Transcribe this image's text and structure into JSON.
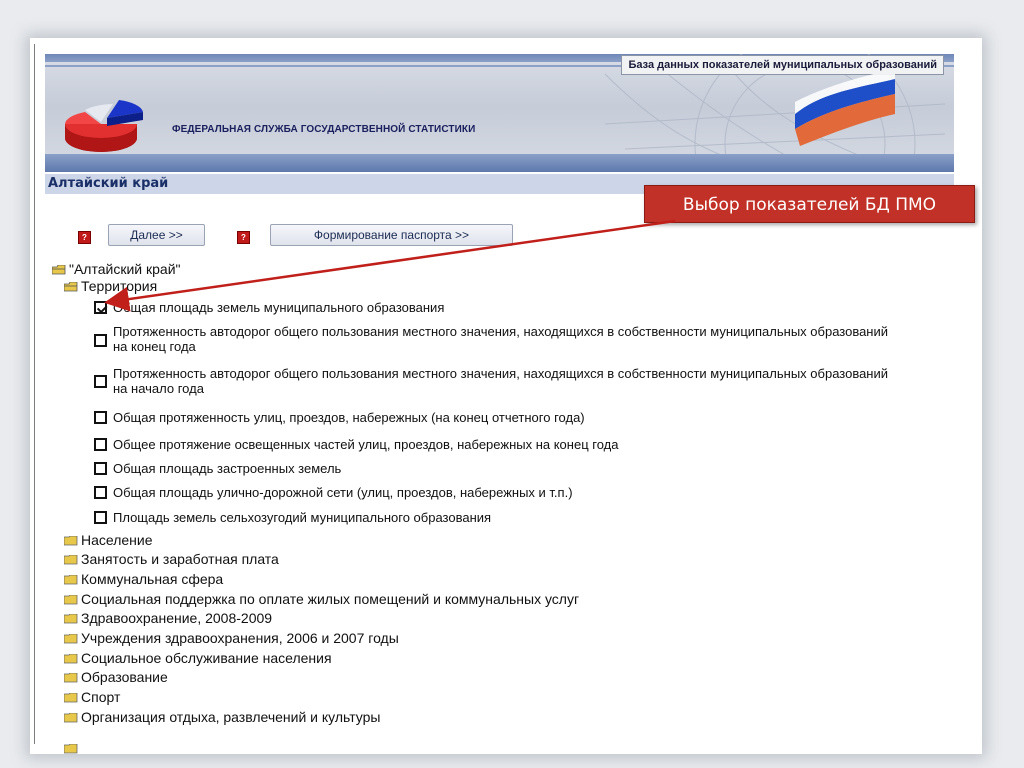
{
  "header": {
    "db_title": "База данных показателей муниципальных образований",
    "agency": "ФЕДЕРАЛЬНАЯ СЛУЖБА ГОСУДАРСТВЕННОЙ СТАТИСТИКИ"
  },
  "region_title": "Алтайский край",
  "callout": "Выбор показателей БД ПМО",
  "buttons": {
    "help_glyph": "?",
    "next": "Далее >>",
    "passport": "Формирование паспорта >>"
  },
  "tree": {
    "root": "\"Алтайский край\"",
    "open_section": "Территория",
    "indicators": [
      {
        "label": "Общая площадь земель муниципального образования",
        "checked": true
      },
      {
        "label": "Протяженность автодорог общего пользования местного значения, находящихся в собственности муниципальных образований на конец года",
        "checked": false
      },
      {
        "label": "Протяженность автодорог общего пользования местного значения, находящихся в собственности муниципальных образований на начало года",
        "checked": false
      },
      {
        "label": "Общая протяженность улиц, проездов, набережных (на конец отчетного года)",
        "checked": false
      },
      {
        "label": "Общее протяжение освещенных частей улиц, проездов, набережных на конец года",
        "checked": false
      },
      {
        "label": "Общая площадь застроенных земель",
        "checked": false
      },
      {
        "label": "Общая площадь улично-дорожной сети (улиц, проездов, набережных и т.п.)",
        "checked": false
      },
      {
        "label": "Площадь земель сельхозугодий муниципального образования",
        "checked": false
      }
    ],
    "sections": [
      "Население",
      "Занятость и заработная плата",
      "Коммунальная сфера",
      "Социальная поддержка по оплате жилых помещений и коммунальных услуг",
      "Здравоохранение, 2008-2009",
      "Учреждения здравоохранения, 2006 и 2007 годы",
      "Социальное обслуживание населения",
      "Образование",
      "Спорт",
      "Организация отдыха, развлечений и культуры"
    ]
  },
  "colors": {
    "region_bg": "#cdd6e8",
    "callout_bg": "#c13127",
    "folder": "#e8c84a"
  }
}
